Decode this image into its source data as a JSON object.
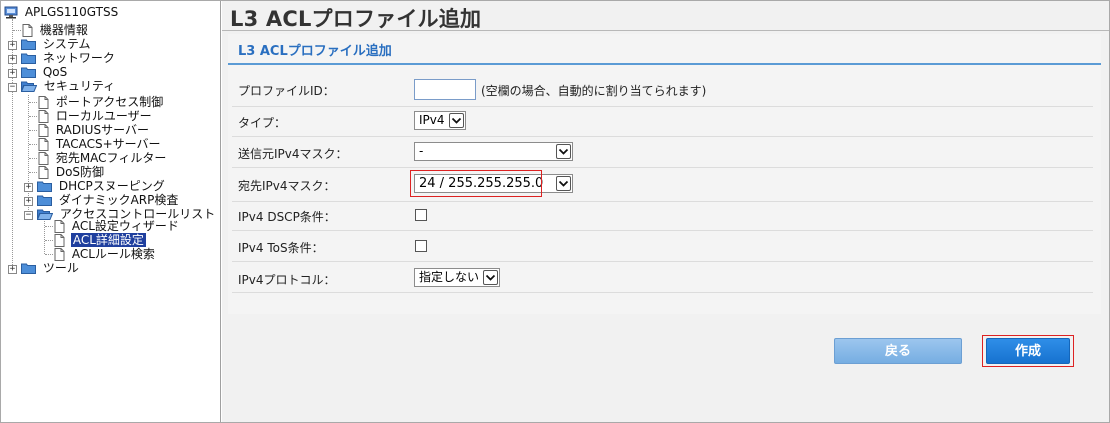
{
  "tree": {
    "root": "APLGS110GTSS",
    "items": [
      {
        "label": "機器情報"
      },
      {
        "label": "システム"
      },
      {
        "label": "ネットワーク"
      },
      {
        "label": "QoS"
      },
      {
        "label": "セキュリティ"
      },
      {
        "label": "ポートアクセス制御"
      },
      {
        "label": "ローカルユーザー"
      },
      {
        "label": "RADIUSサーバー"
      },
      {
        "label": "TACACS+サーバー"
      },
      {
        "label": "宛先MACフィルター"
      },
      {
        "label": "DoS防御"
      },
      {
        "label": "DHCPスヌーピング"
      },
      {
        "label": "ダイナミックARP検査"
      },
      {
        "label": "アクセスコントロールリスト"
      },
      {
        "label": "ACL設定ウィザード"
      },
      {
        "label": "ACL詳細設定"
      },
      {
        "label": "ACLルール検索"
      },
      {
        "label": "ツール"
      }
    ]
  },
  "page": {
    "title": "L3 ACLプロファイル追加",
    "section_title": "L3 ACLプロファイル追加"
  },
  "form": {
    "profile_id_label": "プロファイルID：",
    "profile_id_value": "",
    "profile_id_hint": "(空欄の場合、自動的に割り当てられます)",
    "type_label": "タイプ：",
    "type_value": "IPv4",
    "src_mask_label": "送信元IPv4マスク：",
    "src_mask_value": "-",
    "dst_mask_label": "宛先IPv4マスク：",
    "dst_mask_value": "24 / 255.255.255.0",
    "dscp_label": "IPv4 DSCP条件：",
    "dscp_checked": false,
    "tos_label": "IPv4 ToS条件：",
    "tos_checked": false,
    "protocol_label": "IPv4プロトコル：",
    "protocol_value": "指定しない"
  },
  "buttons": {
    "back": "戻る",
    "create": "作成"
  },
  "colors": {
    "section_title": "#2a6fc0",
    "selected_item": "#1f3f9e",
    "highlight": "#dd2222",
    "create_button": "#1772cf",
    "back_button": "#76aee2"
  }
}
